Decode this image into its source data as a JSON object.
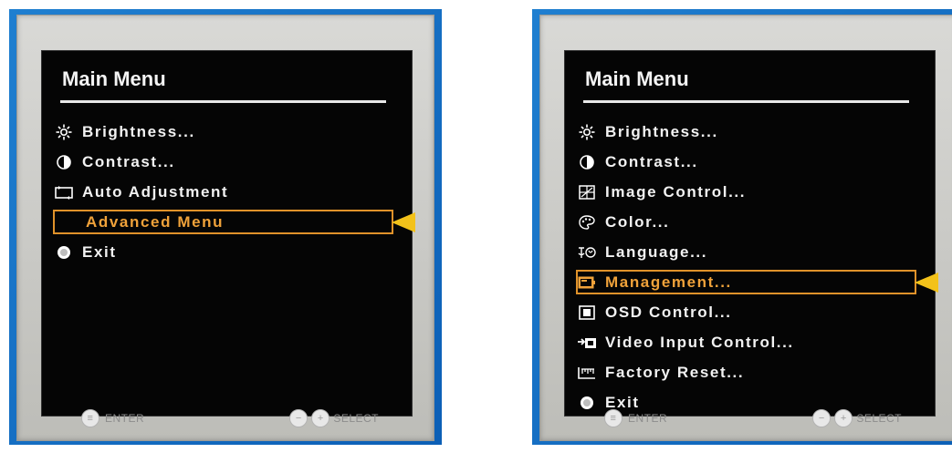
{
  "left_monitor": {
    "osd": {
      "title": "Main Menu",
      "items": [
        {
          "label": "Brightness...",
          "icon": "sun-icon"
        },
        {
          "label": "Contrast...",
          "icon": "contrast-icon"
        },
        {
          "label": "Auto Adjustment",
          "icon": "auto-adjust-icon"
        },
        {
          "label": "Advanced Menu",
          "icon": "",
          "selected": true
        },
        {
          "label": "Exit",
          "icon": "exit-icon"
        }
      ]
    },
    "controls": {
      "enter_label": "ENTER",
      "select_label": "SELECT"
    }
  },
  "right_monitor": {
    "osd": {
      "title": "Main Menu",
      "items": [
        {
          "label": "Brightness...",
          "icon": "sun-icon"
        },
        {
          "label": "Contrast...",
          "icon": "contrast-icon"
        },
        {
          "label": "Image Control...",
          "icon": "image-control-icon"
        },
        {
          "label": "Color...",
          "icon": "color-palette-icon"
        },
        {
          "label": "Language...",
          "icon": "language-icon"
        },
        {
          "label": "Management...",
          "icon": "management-icon",
          "selected": true
        },
        {
          "label": "OSD Control...",
          "icon": "osd-control-icon"
        },
        {
          "label": "Video Input Control...",
          "icon": "video-input-icon"
        },
        {
          "label": "Factory Reset...",
          "icon": "factory-reset-icon"
        },
        {
          "label": "Exit",
          "icon": "exit-icon"
        }
      ]
    },
    "controls": {
      "enter_label": "ENTER",
      "select_label": "SELECT"
    }
  },
  "colors": {
    "highlight": "#e0922a",
    "pointer": "#f3c21a",
    "screen": "#050505",
    "desktop": "#0c5fb6"
  }
}
